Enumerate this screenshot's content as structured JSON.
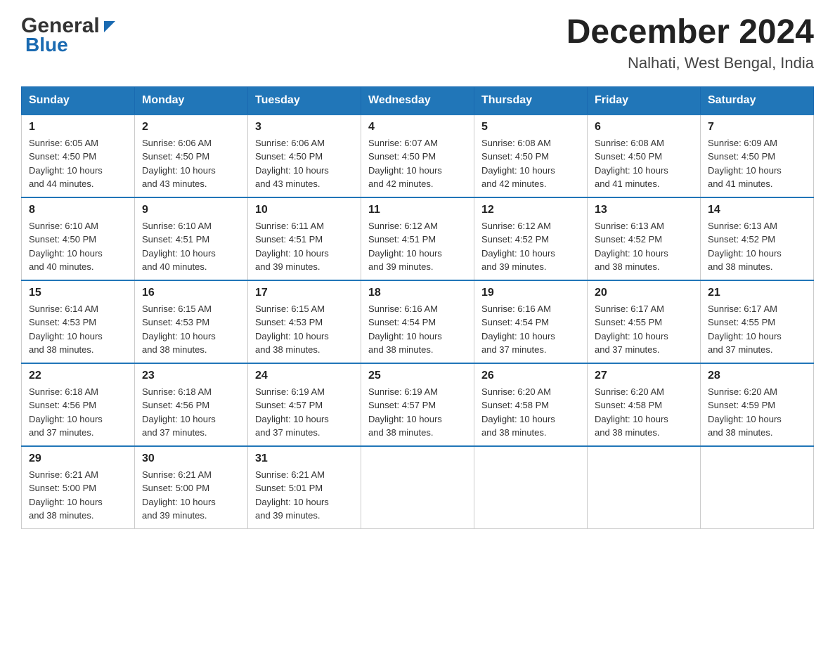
{
  "logo": {
    "general": "General",
    "blue": "Blue",
    "triangle_aria": "logo triangle icon"
  },
  "title": {
    "month_year": "December 2024",
    "location": "Nalhati, West Bengal, India"
  },
  "header_row": [
    "Sunday",
    "Monday",
    "Tuesday",
    "Wednesday",
    "Thursday",
    "Friday",
    "Saturday"
  ],
  "weeks": [
    [
      {
        "day": "1",
        "sunrise": "6:05 AM",
        "sunset": "4:50 PM",
        "daylight": "10 hours and 44 minutes."
      },
      {
        "day": "2",
        "sunrise": "6:06 AM",
        "sunset": "4:50 PM",
        "daylight": "10 hours and 43 minutes."
      },
      {
        "day": "3",
        "sunrise": "6:06 AM",
        "sunset": "4:50 PM",
        "daylight": "10 hours and 43 minutes."
      },
      {
        "day": "4",
        "sunrise": "6:07 AM",
        "sunset": "4:50 PM",
        "daylight": "10 hours and 42 minutes."
      },
      {
        "day": "5",
        "sunrise": "6:08 AM",
        "sunset": "4:50 PM",
        "daylight": "10 hours and 42 minutes."
      },
      {
        "day": "6",
        "sunrise": "6:08 AM",
        "sunset": "4:50 PM",
        "daylight": "10 hours and 41 minutes."
      },
      {
        "day": "7",
        "sunrise": "6:09 AM",
        "sunset": "4:50 PM",
        "daylight": "10 hours and 41 minutes."
      }
    ],
    [
      {
        "day": "8",
        "sunrise": "6:10 AM",
        "sunset": "4:50 PM",
        "daylight": "10 hours and 40 minutes."
      },
      {
        "day": "9",
        "sunrise": "6:10 AM",
        "sunset": "4:51 PM",
        "daylight": "10 hours and 40 minutes."
      },
      {
        "day": "10",
        "sunrise": "6:11 AM",
        "sunset": "4:51 PM",
        "daylight": "10 hours and 39 minutes."
      },
      {
        "day": "11",
        "sunrise": "6:12 AM",
        "sunset": "4:51 PM",
        "daylight": "10 hours and 39 minutes."
      },
      {
        "day": "12",
        "sunrise": "6:12 AM",
        "sunset": "4:52 PM",
        "daylight": "10 hours and 39 minutes."
      },
      {
        "day": "13",
        "sunrise": "6:13 AM",
        "sunset": "4:52 PM",
        "daylight": "10 hours and 38 minutes."
      },
      {
        "day": "14",
        "sunrise": "6:13 AM",
        "sunset": "4:52 PM",
        "daylight": "10 hours and 38 minutes."
      }
    ],
    [
      {
        "day": "15",
        "sunrise": "6:14 AM",
        "sunset": "4:53 PM",
        "daylight": "10 hours and 38 minutes."
      },
      {
        "day": "16",
        "sunrise": "6:15 AM",
        "sunset": "4:53 PM",
        "daylight": "10 hours and 38 minutes."
      },
      {
        "day": "17",
        "sunrise": "6:15 AM",
        "sunset": "4:53 PM",
        "daylight": "10 hours and 38 minutes."
      },
      {
        "day": "18",
        "sunrise": "6:16 AM",
        "sunset": "4:54 PM",
        "daylight": "10 hours and 38 minutes."
      },
      {
        "day": "19",
        "sunrise": "6:16 AM",
        "sunset": "4:54 PM",
        "daylight": "10 hours and 37 minutes."
      },
      {
        "day": "20",
        "sunrise": "6:17 AM",
        "sunset": "4:55 PM",
        "daylight": "10 hours and 37 minutes."
      },
      {
        "day": "21",
        "sunrise": "6:17 AM",
        "sunset": "4:55 PM",
        "daylight": "10 hours and 37 minutes."
      }
    ],
    [
      {
        "day": "22",
        "sunrise": "6:18 AM",
        "sunset": "4:56 PM",
        "daylight": "10 hours and 37 minutes."
      },
      {
        "day": "23",
        "sunrise": "6:18 AM",
        "sunset": "4:56 PM",
        "daylight": "10 hours and 37 minutes."
      },
      {
        "day": "24",
        "sunrise": "6:19 AM",
        "sunset": "4:57 PM",
        "daylight": "10 hours and 37 minutes."
      },
      {
        "day": "25",
        "sunrise": "6:19 AM",
        "sunset": "4:57 PM",
        "daylight": "10 hours and 38 minutes."
      },
      {
        "day": "26",
        "sunrise": "6:20 AM",
        "sunset": "4:58 PM",
        "daylight": "10 hours and 38 minutes."
      },
      {
        "day": "27",
        "sunrise": "6:20 AM",
        "sunset": "4:58 PM",
        "daylight": "10 hours and 38 minutes."
      },
      {
        "day": "28",
        "sunrise": "6:20 AM",
        "sunset": "4:59 PM",
        "daylight": "10 hours and 38 minutes."
      }
    ],
    [
      {
        "day": "29",
        "sunrise": "6:21 AM",
        "sunset": "5:00 PM",
        "daylight": "10 hours and 38 minutes."
      },
      {
        "day": "30",
        "sunrise": "6:21 AM",
        "sunset": "5:00 PM",
        "daylight": "10 hours and 39 minutes."
      },
      {
        "day": "31",
        "sunrise": "6:21 AM",
        "sunset": "5:01 PM",
        "daylight": "10 hours and 39 minutes."
      },
      null,
      null,
      null,
      null
    ]
  ],
  "labels": {
    "sunrise": "Sunrise:",
    "sunset": "Sunset:",
    "daylight": "Daylight:"
  }
}
